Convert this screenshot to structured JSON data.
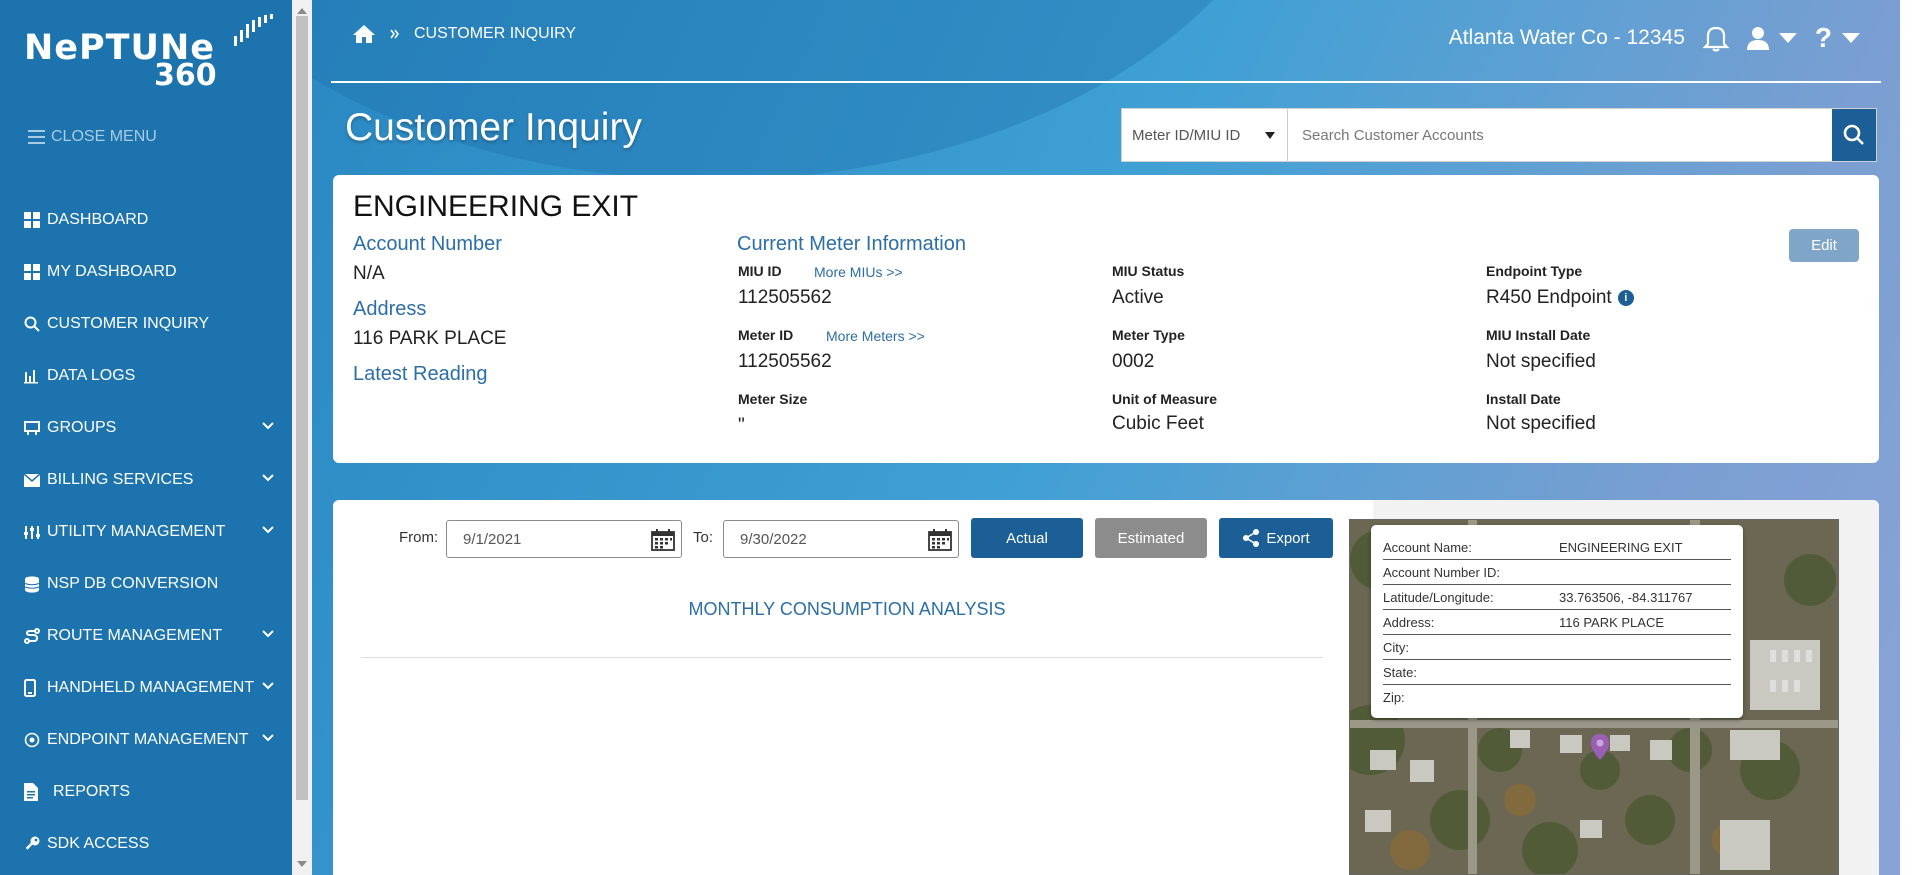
{
  "brand": {
    "logo_word": "NePTUNe",
    "logo_number": "360"
  },
  "sidebar": {
    "close_menu": "CLOSE MENU",
    "items": [
      {
        "label": "DASHBOARD",
        "icon": "grid-icon"
      },
      {
        "label": "MY DASHBOARD",
        "icon": "grid-icon"
      },
      {
        "label": "CUSTOMER INQUIRY",
        "icon": "search-icon"
      },
      {
        "label": "DATA LOGS",
        "icon": "bar-chart-icon"
      },
      {
        "label": "GROUPS",
        "icon": "groups-icon"
      },
      {
        "label": "BILLING SERVICES",
        "icon": "envelope-icon"
      },
      {
        "label": "UTILITY MANAGEMENT",
        "icon": "sliders-icon"
      },
      {
        "label": "NSP DB CONVERSION",
        "icon": "database-icon"
      },
      {
        "label": "ROUTE MANAGEMENT",
        "icon": "route-icon"
      },
      {
        "label": "HANDHELD MANAGEMENT",
        "icon": "handheld-icon"
      },
      {
        "label": "ENDPOINT MANAGEMENT",
        "icon": "target-icon"
      },
      {
        "label": "REPORTS",
        "icon": "document-icon"
      },
      {
        "label": "SDK ACCESS",
        "icon": "key-icon"
      }
    ]
  },
  "header": {
    "breadcrumb": "CUSTOMER INQUIRY",
    "account": "Atlanta Water Co - 12345",
    "page_title": "Customer Inquiry"
  },
  "search": {
    "select_value": "Meter ID/MIU ID",
    "placeholder": "Search Customer Accounts"
  },
  "customer": {
    "name": "ENGINEERING EXIT",
    "account_number_label": "Account Number",
    "account_number": "N/A",
    "address_label": "Address",
    "address": "116 PARK PLACE",
    "latest_reading_label": "Latest Reading",
    "meter_info_label": "Current Meter Information",
    "miu_id_label": "MIU ID",
    "more_mius": "More MIUs >>",
    "miu_id": "112505562",
    "meter_id_label": "Meter ID",
    "more_meters": "More Meters >>",
    "meter_id": "112505562",
    "meter_size_label": "Meter Size",
    "meter_size": "\"",
    "miu_status_label": "MIU Status",
    "miu_status": "Active",
    "meter_type_label": "Meter Type",
    "meter_type": "0002",
    "unit_label": "Unit of Measure",
    "unit": "Cubic Feet",
    "endpoint_type_label": "Endpoint Type",
    "endpoint_type": "R450 Endpoint",
    "miu_install_label": "MIU Install Date",
    "miu_install": "Not specified",
    "install_date_label": "Install Date",
    "install_date": "Not specified",
    "edit_label": "Edit"
  },
  "consumption": {
    "from_label": "From:",
    "from_value": "9/1/2021",
    "to_label": "To:",
    "to_value": "9/30/2022",
    "actual_label": "Actual",
    "estimated_label": "Estimated",
    "export_label": "Export",
    "title": "MONTHLY CONSUMPTION ANALYSIS"
  },
  "map_popup": {
    "rows": [
      {
        "k": "Account Name:",
        "v": "ENGINEERING EXIT"
      },
      {
        "k": "Account Number ID:",
        "v": ""
      },
      {
        "k": "Latitude/Longitude:",
        "v": "33.763506, -84.311767"
      },
      {
        "k": "Address:",
        "v": "116 PARK PLACE"
      },
      {
        "k": "City:",
        "v": ""
      },
      {
        "k": "State:",
        "v": ""
      },
      {
        "k": "Zip:",
        "v": ""
      }
    ]
  },
  "colors": {
    "sidebar": "#1c73ad",
    "primary_button": "#1c5f96",
    "estimated_button": "#8c8c8c",
    "link": "#2c6ea6"
  }
}
